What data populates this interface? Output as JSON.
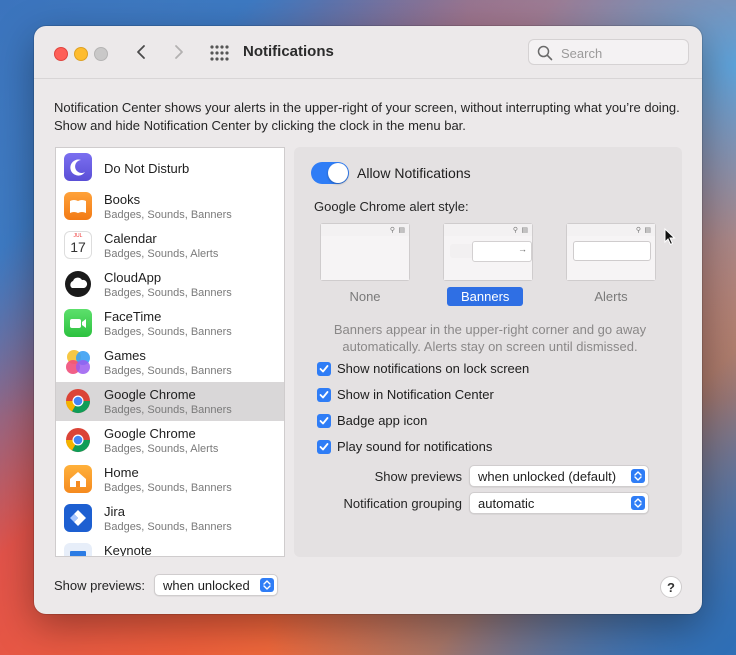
{
  "window": {
    "title": "Notifications",
    "search_placeholder": "Search",
    "intro_text": "Notification Center shows your alerts in the upper-right of your screen, without interrupting what you’re doing. Show and hide Notification Center by clicking the clock in the menu bar."
  },
  "apps": [
    {
      "name": "Do Not Disturb",
      "sub": "",
      "icon": "moon-icon"
    },
    {
      "name": "Books",
      "sub": "Badges, Sounds, Banners",
      "icon": "books-icon"
    },
    {
      "name": "Calendar",
      "sub": "Badges, Sounds, Alerts",
      "icon": "calendar-icon",
      "icon_month": "JUL",
      "icon_day": "17"
    },
    {
      "name": "CloudApp",
      "sub": "Badges, Sounds, Banners",
      "icon": "cloud-icon"
    },
    {
      "name": "FaceTime",
      "sub": "Badges, Sounds, Banners",
      "icon": "facetime-icon"
    },
    {
      "name": "Games",
      "sub": "Badges, Sounds, Banners",
      "icon": "games-icon"
    },
    {
      "name": "Google Chrome",
      "sub": "Badges, Sounds, Banners",
      "icon": "chrome-icon",
      "selected": true
    },
    {
      "name": "Google Chrome",
      "sub": "Badges, Sounds, Alerts",
      "icon": "chrome-icon"
    },
    {
      "name": "Home",
      "sub": "Badges, Sounds, Banners",
      "icon": "home-icon"
    },
    {
      "name": "Jira",
      "sub": "Badges, Sounds, Banners",
      "icon": "jira-icon"
    },
    {
      "name": "Keynote",
      "sub": "",
      "icon": "keynote-icon"
    }
  ],
  "panel": {
    "allow_label": "Allow Notifications",
    "allow_enabled": true,
    "style_label": "Google Chrome alert style:",
    "styles": [
      "None",
      "Banners",
      "Alerts"
    ],
    "selected_style": "Banners",
    "description": "Banners appear in the upper-right corner and go away automatically. Alerts stay on screen until dismissed.",
    "checks": [
      {
        "label": "Show notifications on lock screen",
        "checked": true
      },
      {
        "label": "Show in Notification Center",
        "checked": true
      },
      {
        "label": "Badge app icon",
        "checked": true
      },
      {
        "label": "Play sound for notifications",
        "checked": true
      }
    ],
    "show_previews_label": "Show previews",
    "show_previews_value": "when unlocked (default)",
    "grouping_label": "Notification grouping",
    "grouping_value": "automatic"
  },
  "footer": {
    "show_previews_label": "Show previews:",
    "show_previews_value": "when unlocked",
    "help_label": "?"
  },
  "colors": {
    "accent": "#2f7df6",
    "selected_row": "#d9d7d8",
    "window_bg": "#ece9ea"
  }
}
